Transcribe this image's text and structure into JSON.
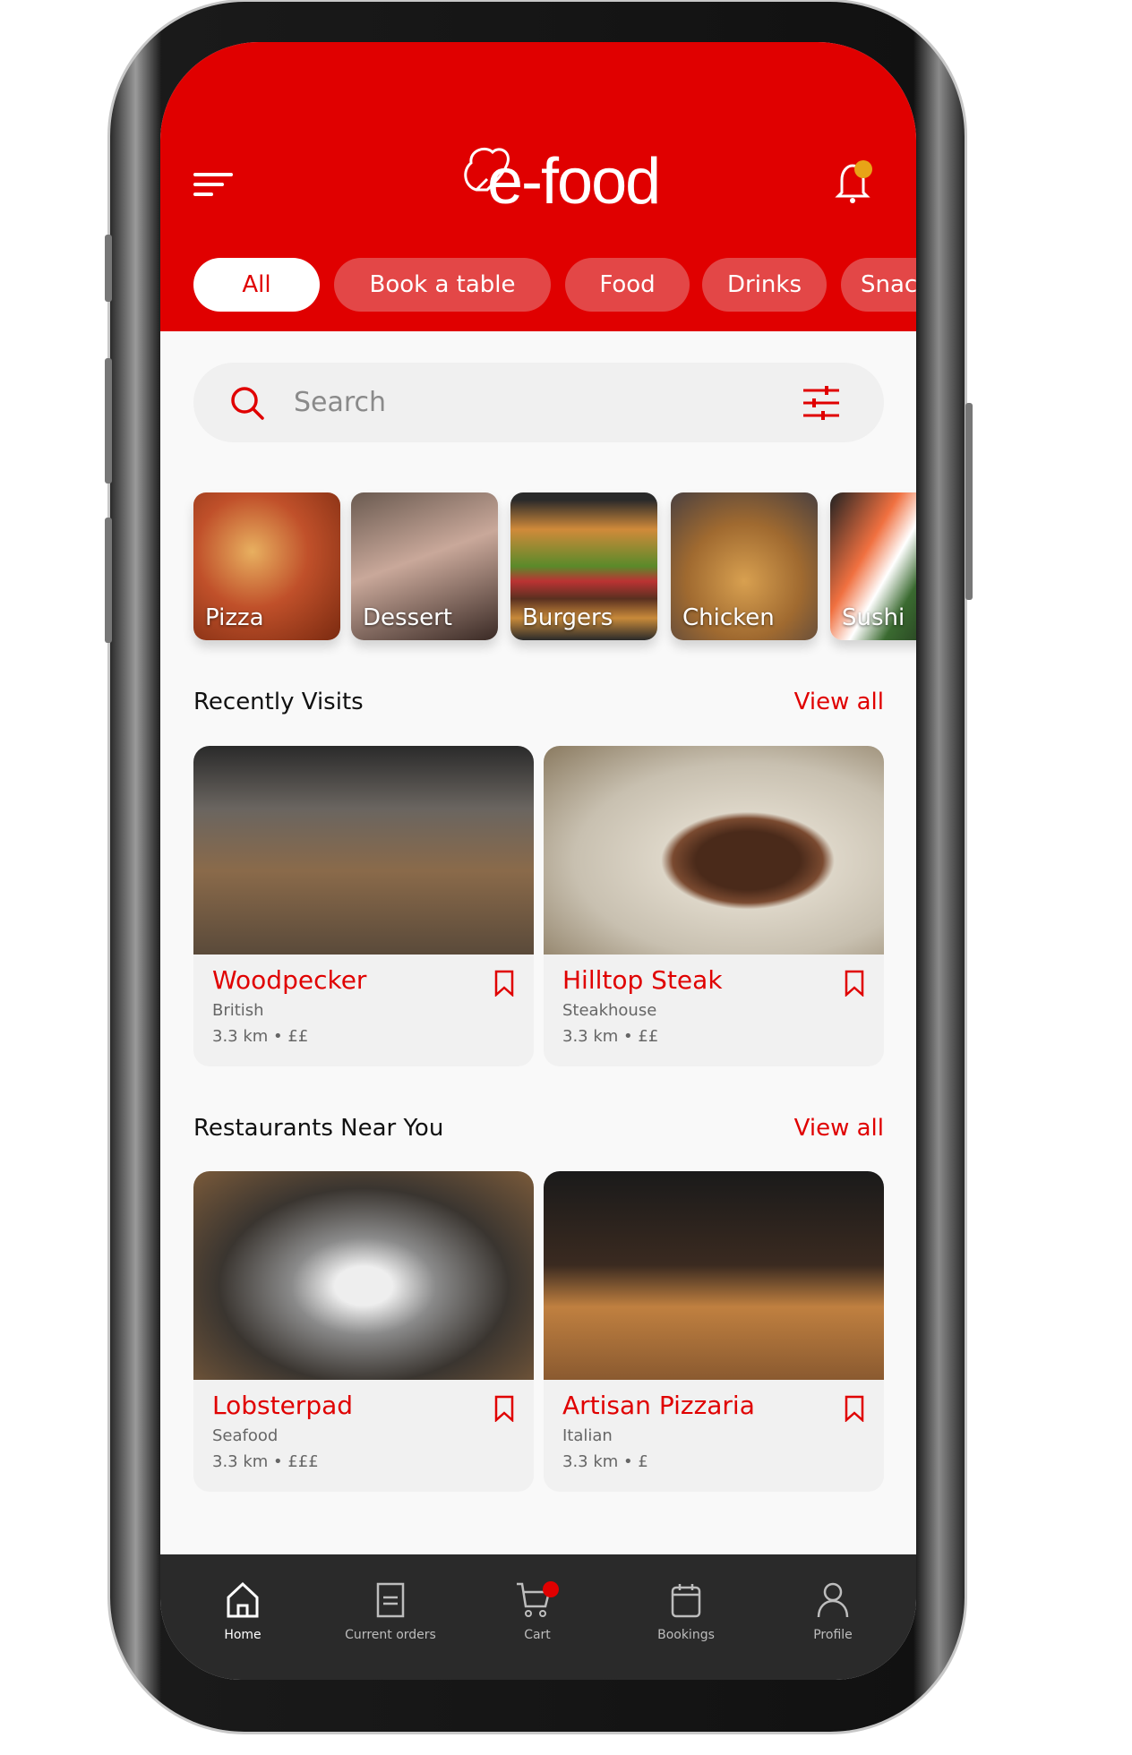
{
  "app": {
    "logo": "e-food",
    "brand_color": "#e00000"
  },
  "header": {
    "menu_icon": "hamburger-icon",
    "notification_icon": "bell-icon",
    "notification_dot_color": "#e8a317"
  },
  "filters": [
    {
      "label": "All",
      "active": true
    },
    {
      "label": "Book a table"
    },
    {
      "label": "Food"
    },
    {
      "label": "Drinks"
    },
    {
      "label": "Snac"
    }
  ],
  "search": {
    "placeholder": "Search",
    "icon": "search-icon",
    "filter_icon": "sliders-icon"
  },
  "categories": [
    {
      "label": "Pizza"
    },
    {
      "label": "Dessert"
    },
    {
      "label": "Burgers"
    },
    {
      "label": "Chicken"
    },
    {
      "label": "Sushi"
    }
  ],
  "recent": {
    "title": "Recently Visits",
    "view_all": "View all",
    "items": [
      {
        "name": "Woodpecker",
        "cuisine": "British",
        "meta": "3.3 km • ££"
      },
      {
        "name": "Hilltop Steak",
        "cuisine": "Steakhouse",
        "meta": "3.3 km • ££"
      }
    ]
  },
  "nearby": {
    "title": "Restaurants Near You",
    "view_all": "View all",
    "items": [
      {
        "name": "Lobsterpad",
        "cuisine": "Seafood",
        "meta": "3.3 km • £££"
      },
      {
        "name": "Artisan Pizzaria",
        "cuisine": "Italian",
        "meta": "3.3 km • £"
      }
    ]
  },
  "nav": [
    {
      "label": "Home",
      "active": true
    },
    {
      "label": "Current orders"
    },
    {
      "label": "Cart"
    },
    {
      "label": "Bookings"
    },
    {
      "label": "Profile"
    }
  ]
}
